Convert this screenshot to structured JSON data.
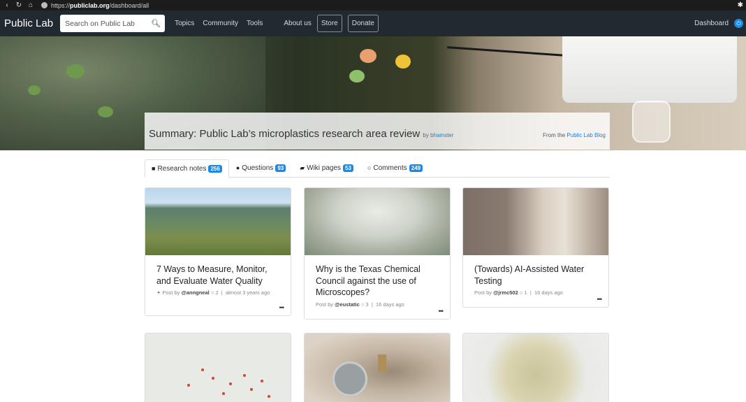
{
  "browser": {
    "url_prefix": "https://",
    "url_host": "publiclab.org",
    "url_path": "/dashboard/all"
  },
  "navbar": {
    "brand": "Public Lab",
    "search_placeholder": "Search on Public Lab",
    "links": [
      "Topics",
      "Community",
      "Tools"
    ],
    "about": "About us",
    "store": "Store",
    "donate": "Donate",
    "dashboard": "Dashboard"
  },
  "hero": {
    "title": "Summary: Public Lab’s microplastics research area review",
    "by_label": "by",
    "author": "bhamster",
    "source_prefix": "From the",
    "source_link": "Public Lab Blog"
  },
  "tabs": [
    {
      "label": "Research notes",
      "count": "256",
      "icon": "file-icon"
    },
    {
      "label": "Questions",
      "count": "93",
      "icon": "question-circle-icon"
    },
    {
      "label": "Wiki pages",
      "count": "53",
      "icon": "book-icon"
    },
    {
      "label": "Comments",
      "count": "249",
      "icon": "comment-icon"
    }
  ],
  "cards": [
    {
      "title": "7 Ways to Measure, Monitor, and Evaluate Water Quality",
      "meta_prefix": "Post by",
      "author": "@anngneal",
      "comments": "2",
      "time": "almost 3 years ago",
      "pinned": true
    },
    {
      "title": "Why is the Texas Chemical Council against the use of Microscopes?",
      "meta_prefix": "Post by",
      "author": "@eustatic",
      "comments": "3",
      "time": "16 days ago"
    },
    {
      "title": "(Towards) AI-Assisted Water Testing",
      "meta_prefix": "Post by",
      "author": "@jrmc502",
      "comments": "1",
      "time": "16 days ago"
    }
  ],
  "more_glyph": "•••",
  "colors": {
    "navbar": "#212a30",
    "accent": "#1e88e5"
  }
}
